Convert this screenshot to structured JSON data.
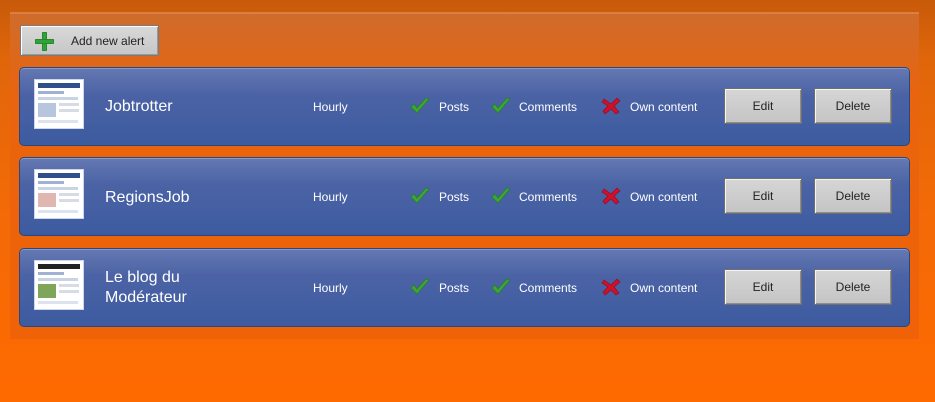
{
  "toolbar": {
    "add_label": "Add new alert"
  },
  "colors": {
    "check": "#3ea53a",
    "cross": "#d0102a",
    "row": "#4b63a5"
  },
  "alerts": [
    {
      "name": "Jobtrotter",
      "frequency": "Hourly",
      "options": [
        {
          "label": "Posts",
          "enabled": true
        },
        {
          "label": "Comments",
          "enabled": true
        },
        {
          "label": "Own content",
          "enabled": false
        }
      ],
      "edit_label": "Edit",
      "delete_label": "Delete"
    },
    {
      "name": "RegionsJob",
      "frequency": "Hourly",
      "options": [
        {
          "label": "Posts",
          "enabled": true
        },
        {
          "label": "Comments",
          "enabled": true
        },
        {
          "label": "Own content",
          "enabled": false
        }
      ],
      "edit_label": "Edit",
      "delete_label": "Delete"
    },
    {
      "name": "Le blog du Modérateur",
      "name_lines": [
        "Le blog du",
        "Modérateur"
      ],
      "frequency": "Hourly",
      "options": [
        {
          "label": "Posts",
          "enabled": true
        },
        {
          "label": "Comments",
          "enabled": true
        },
        {
          "label": "Own content",
          "enabled": false
        }
      ],
      "edit_label": "Edit",
      "delete_label": "Delete"
    }
  ]
}
